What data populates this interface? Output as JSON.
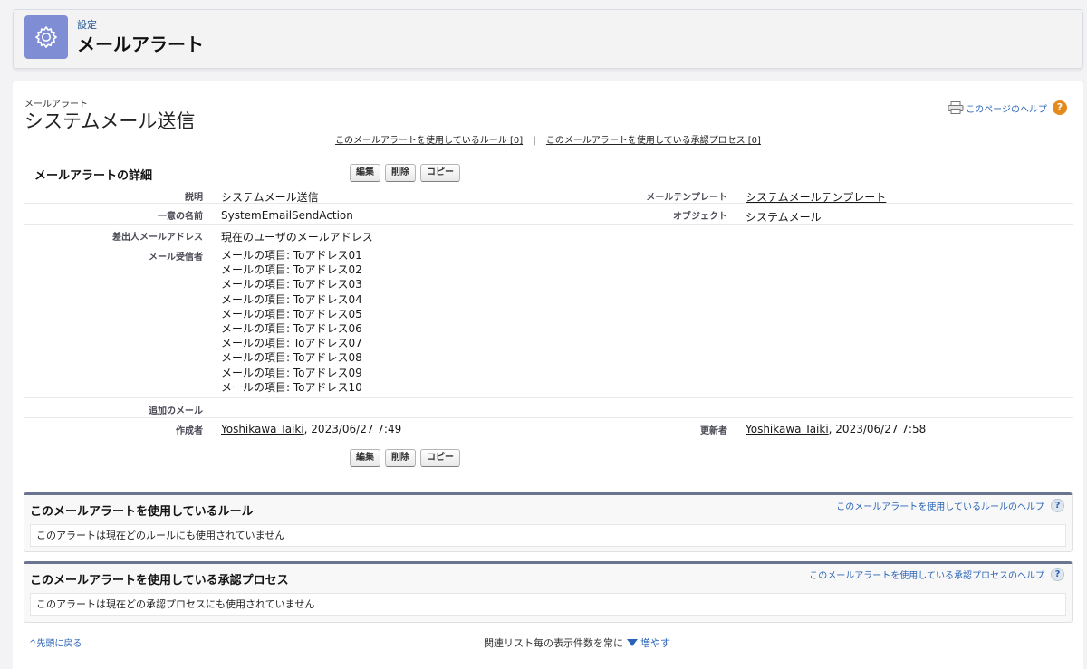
{
  "header": {
    "eyebrow": "設定",
    "title": "メールアラート"
  },
  "page": {
    "eyebrow": "メールアラート",
    "title": "システムメール送信",
    "help_label": "このページのヘルプ",
    "help_badge": "?"
  },
  "related_links": {
    "rules": "このメールアラートを使用しているルール",
    "rules_count": "[0]",
    "separator": "|",
    "approvals": "このメールアラートを使用している承認プロセス",
    "approvals_count": "[0]"
  },
  "detail": {
    "section_title": "メールアラートの詳細",
    "buttons": {
      "edit": "編集",
      "delete": "削除",
      "copy": "コピー"
    },
    "description_label": "説明",
    "description_value": "システムメール送信",
    "template_label": "メールテンプレート",
    "template_value": "システムメールテンプレート",
    "unique_name_label": "一意の名前",
    "unique_name_value": "SystemEmailSendAction",
    "object_label": "オブジェクト",
    "object_value": "システムメール",
    "sender_label": "差出人メールアドレス",
    "sender_value": "現在のユーザのメールアドレス",
    "recipients_label": "メール受信者",
    "recipients": [
      "メールの項目: Toアドレス01",
      "メールの項目: Toアドレス02",
      "メールの項目: Toアドレス03",
      "メールの項目: Toアドレス04",
      "メールの項目: Toアドレス05",
      "メールの項目: Toアドレス06",
      "メールの項目: Toアドレス07",
      "メールの項目: Toアドレス08",
      "メールの項目: Toアドレス09",
      "メールの項目: Toアドレス10"
    ],
    "additional_label": "追加のメール",
    "created_label": "作成者",
    "created_user": "Yoshikawa Taiki",
    "created_date": ", 2023/06/27 7:49",
    "modified_label": "更新者",
    "modified_user": "Yoshikawa Taiki",
    "modified_date": ", 2023/06/27 7:58"
  },
  "rules_section": {
    "title": "このメールアラートを使用しているルール",
    "help": "このメールアラートを使用しているルールのヘルプ",
    "empty": "このアラートは現在どのルールにも使用されていません"
  },
  "approval_section": {
    "title": "このメールアラートを使用している承認プロセス",
    "help": "このメールアラートを使用している承認プロセスのヘルプ",
    "empty": "このアラートは現在どの承認プロセスにも使用されていません"
  },
  "footer": {
    "back_to_top": "先頭に戻る",
    "show_more_prefix": "関連リスト毎の表示件数を常に",
    "show_more_link": "増やす"
  },
  "colors": {
    "accent": "#7f8ed4",
    "link": "#2a63b6",
    "help_badge": "#e48a1c"
  }
}
